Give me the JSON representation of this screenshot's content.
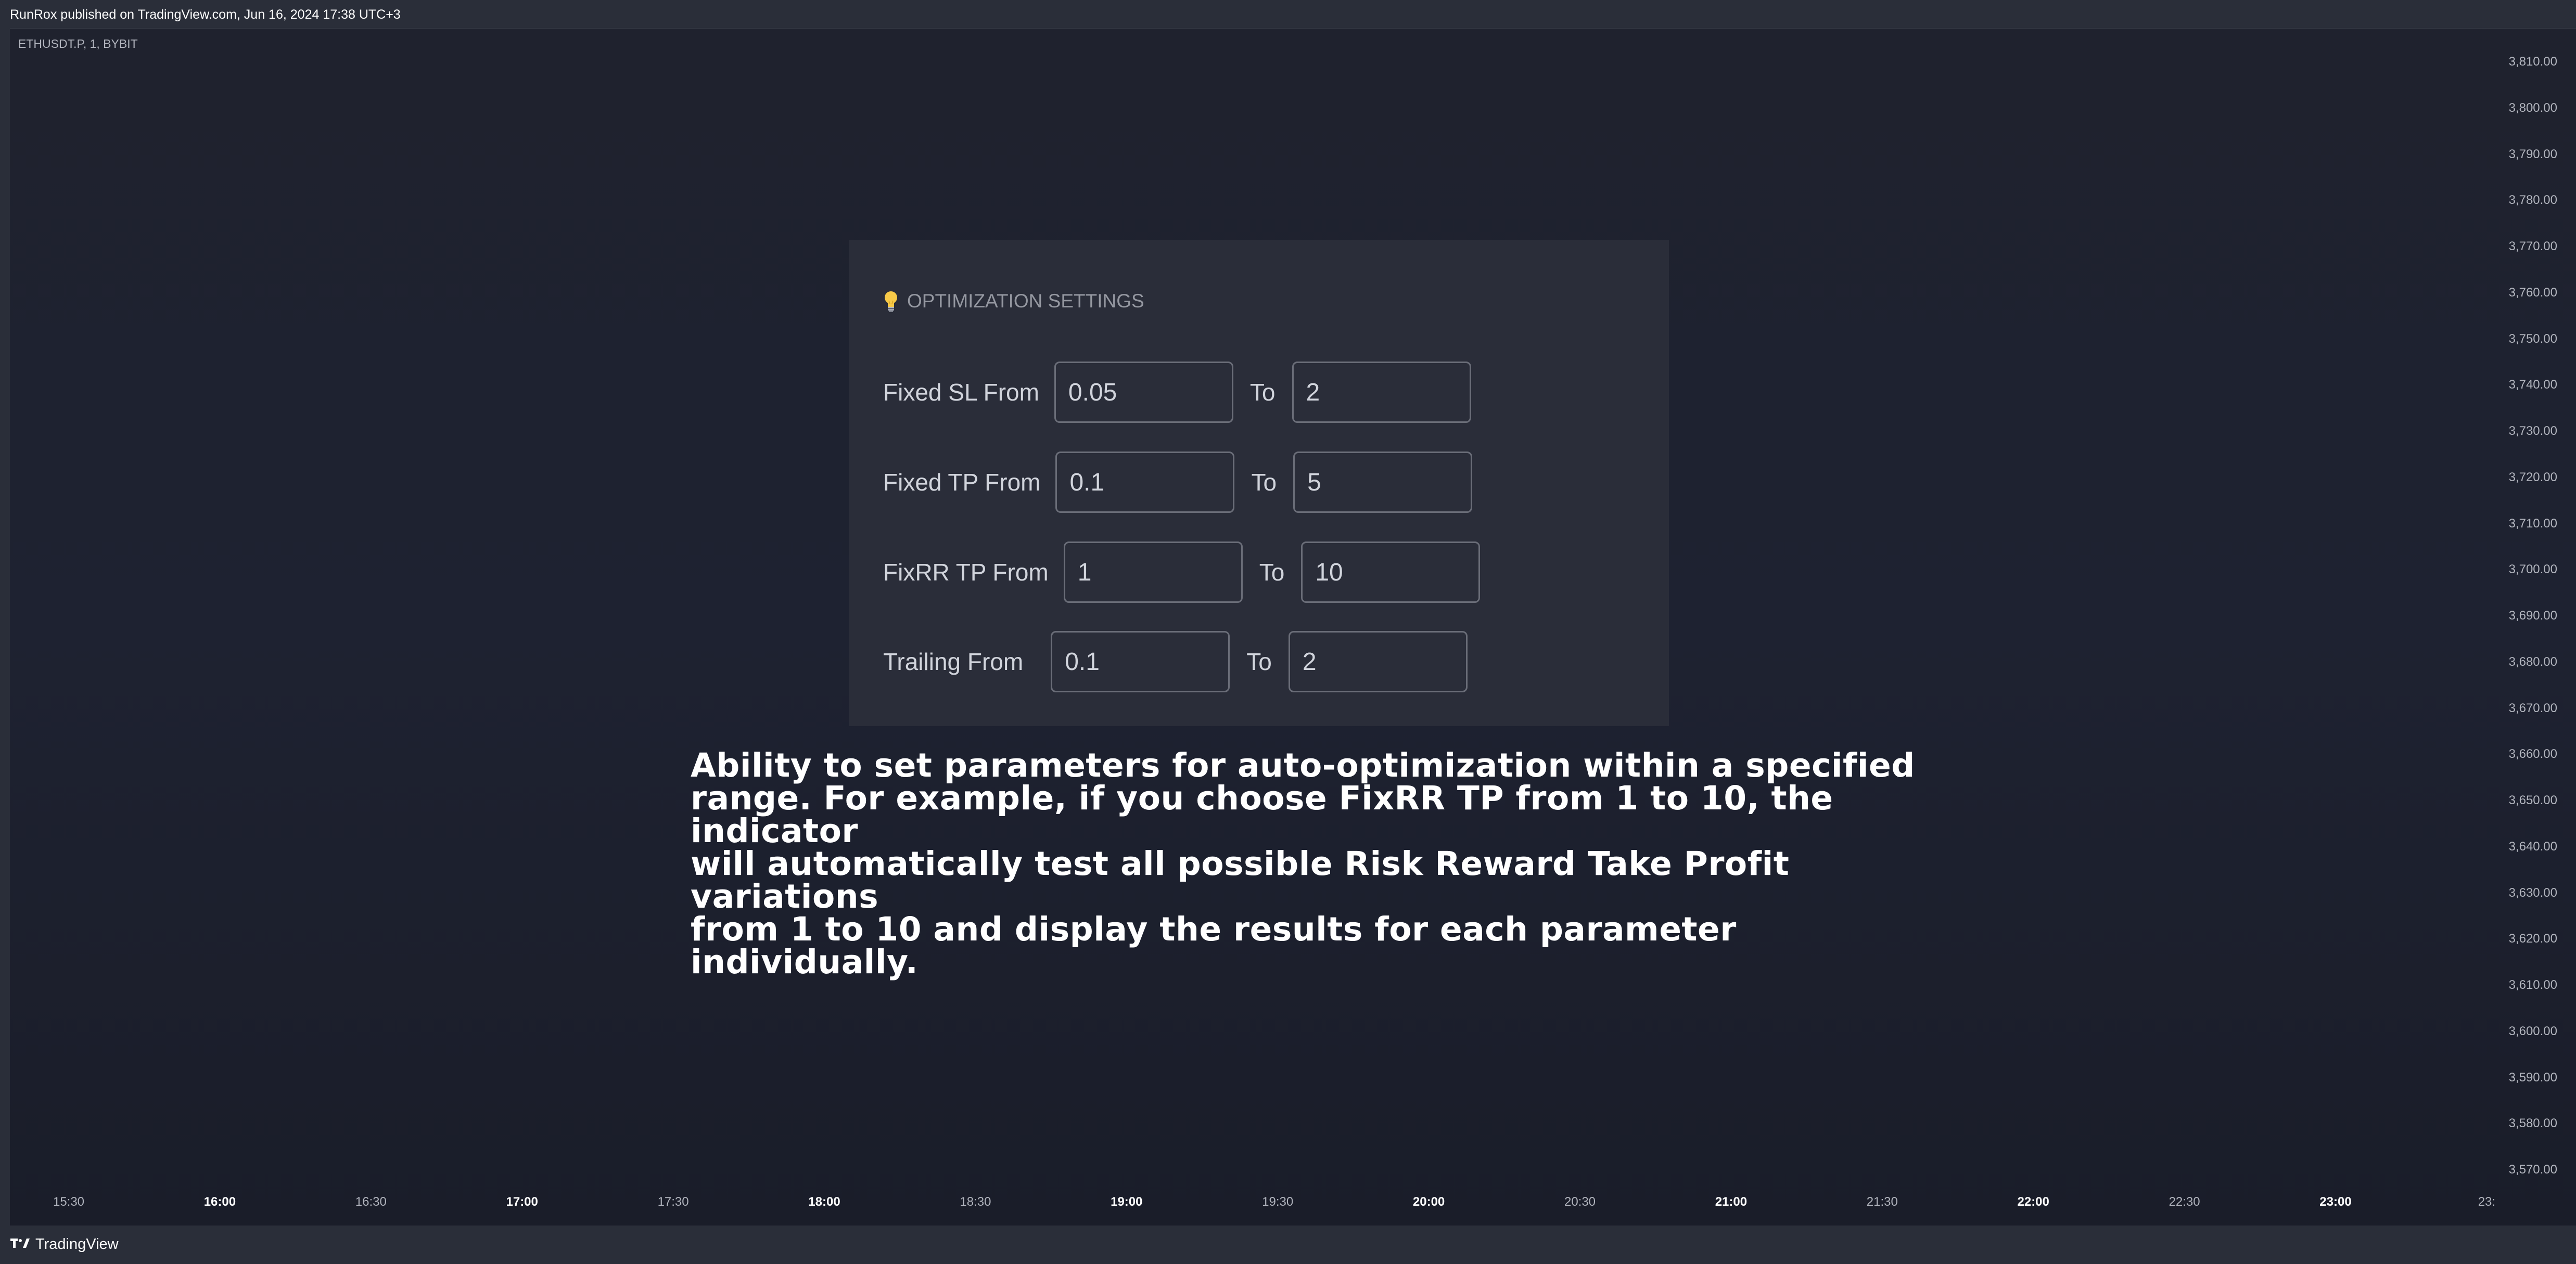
{
  "publish_bar": {
    "text": "RunRox published on TradingView.com, Jun 16, 2024 17:38 UTC+3"
  },
  "chart": {
    "symbol": "ETHUSDT.P, 1, BYBIT",
    "y_ticks": [
      "3,810.00",
      "3,800.00",
      "3,790.00",
      "3,780.00",
      "3,770.00",
      "3,760.00",
      "3,750.00",
      "3,740.00",
      "3,730.00",
      "3,720.00",
      "3,710.00",
      "3,700.00",
      "3,690.00",
      "3,680.00",
      "3,670.00",
      "3,660.00",
      "3,650.00",
      "3,640.00",
      "3,630.00",
      "3,620.00",
      "3,610.00",
      "3,600.00",
      "3,590.00",
      "3,580.00",
      "3,570.00"
    ],
    "x_ticks": [
      {
        "label": "15:30",
        "bold": false
      },
      {
        "label": "16:00",
        "bold": true
      },
      {
        "label": "16:30",
        "bold": false
      },
      {
        "label": "17:00",
        "bold": true
      },
      {
        "label": "17:30",
        "bold": false
      },
      {
        "label": "18:00",
        "bold": true
      },
      {
        "label": "18:30",
        "bold": false
      },
      {
        "label": "19:00",
        "bold": true
      },
      {
        "label": "19:30",
        "bold": false
      },
      {
        "label": "20:00",
        "bold": true
      },
      {
        "label": "20:30",
        "bold": false
      },
      {
        "label": "21:00",
        "bold": true
      },
      {
        "label": "21:30",
        "bold": false
      },
      {
        "label": "22:00",
        "bold": true
      },
      {
        "label": "22:30",
        "bold": false
      },
      {
        "label": "23:00",
        "bold": true
      },
      {
        "label": "23:",
        "bold": false
      }
    ]
  },
  "settings_panel": {
    "icon": "lightbulb-icon",
    "title": "OPTIMIZATION SETTINGS",
    "to_label": "To",
    "rows": [
      {
        "label": "Fixed SL From",
        "from": "0.05",
        "to": "2"
      },
      {
        "label": "Fixed TP From",
        "from": "0.1",
        "to": "5"
      },
      {
        "label": "FixRR TP From",
        "from": "1",
        "to": "10"
      },
      {
        "label": "Trailing From",
        "from": "0.1",
        "to": "2"
      }
    ]
  },
  "caption": {
    "lines": [
      "Ability to set parameters for auto-optimization within a specified",
      "range. For example, if you choose FixRR TP from 1 to 10, the indicator",
      "will automatically test all possible Risk Reward Take Profit variations",
      "from 1 to 10 and display the results for each parameter individually."
    ]
  },
  "footer": {
    "brand": "TradingView",
    "icon": "tradingview-logo-icon"
  },
  "colors": {
    "background": "#1e2231",
    "panel": "#2a2d39",
    "text": "#d1d4dc",
    "field_border": "#6a6d78",
    "caption": "#ffffff"
  }
}
